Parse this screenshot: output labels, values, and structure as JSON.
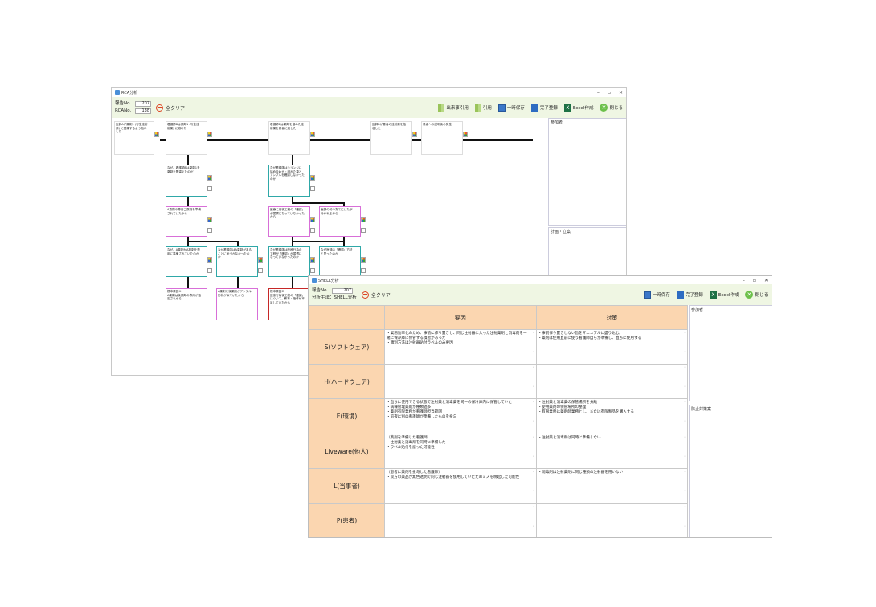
{
  "rca_window": {
    "title": "RCA分析",
    "report_no_label": "報告No.",
    "report_no": "207",
    "rca_no_label": "RCANo.",
    "rca_no": "138",
    "clear_label": "全クリア",
    "toolbar": {
      "source_event": "出来事引用",
      "cite": "引用",
      "temp_save": "一時保存",
      "complete": "完了登録",
      "excel": "Excel作成",
      "close": "閉じる"
    },
    "participants_label": "参加者",
    "plan_label": "計画・立案",
    "nodes": {
      "n1": "医師Aが薬剤1 (写生注射薬) に発薬するよう指示した",
      "n2": "看護師Bは薬剤1 (写生注射薬) に溶めた",
      "n3": "看護師Bは薬剤を溶めた注射薬を患者に渡した",
      "n4": "医師Bが患者の注射薬を指名した",
      "n5": "患者への説明後の発生",
      "t1": "なぜ、看護師Bは薬剤1を薬剤を間違えたのか？",
      "t2": "なぜ看護師はシリンジに詰め合わせ・誤れた薬とアンプルを確認しなかったのか",
      "p1": "A薬剤の専用ご薬剤を準備されていたから",
      "p2": "医療に用後工程の「確認」が習慣になっていなかったから",
      "p3": "医師の可の為てにいたが分かれるから",
      "t3": "なぜ、A薬剤がA薬剤を専用に準備されていたのか",
      "t4": "なぜ看護師はA薬剤があることに気づかなかったのか",
      "t5": "なぜ看護師は医療行為の工程が「確認」が習慣になっていなかったのか",
      "t6": "なぜ医師は「確認」方法と思ったのか",
      "r1": "根本原因①",
      "r1b": "A薬剤は後薬剤の専用が指定されから",
      "r2": "A薬剤と後薬剤がアンプル形状が似ていたから",
      "r3": "根本原因②",
      "r3b": "医療行為後工程の「確認」について、教育・指導が不足していたから"
    }
  },
  "shell_window": {
    "title": "SHELL分析",
    "report_no_label": "報告No.",
    "report_no": "207",
    "method_label": "分析手法：SHELL分析",
    "clear_label": "全クリア",
    "toolbar": {
      "temp_save": "一時保存",
      "complete": "完了登録",
      "excel": "Excel作成",
      "close": "閉じる"
    },
    "col_cause": "要因",
    "col_measure": "対策",
    "participants_label": "参加者",
    "prevention_label": "防止対策案",
    "rows": [
      {
        "label": "S(ソフトウェア)",
        "cause": "・業務効率化のため、事前に作り置きし、同じ注射器に入った注射薬剤と消毒剤を一緒に保冷庫に保管する慣習があった\n・識別方法は注射器貼付ラベルのみ要因",
        "measure": "・事前作り置きしない旨をマニュアルに盛り込む。\n・薬剤は使用直前に使う看護師自らが準備し、直ちに使用する"
      },
      {
        "label": "H(ハードウェア)",
        "cause": "",
        "measure": ""
      },
      {
        "label": "E(環境)",
        "cause": "・直ちに使用できる状態で注射薬と消毒薬を同一の保冷庫内に保管していた\n・病棟管理薬剤が種類過多\n・薬剤有限業務が看護師担当範囲\n・前夜に別の看護師が準備したものを投与",
        "measure": "・注射薬と消毒薬の保管場所を分離\n・使用薬剤の保管場所の整理\n・有限業務は薬剤師業務とし、または有限製品を購入する"
      },
      {
        "label": "Liveware(他人)",
        "cause": "（薬剤を準備した看護師）\n・注射薬と消毒剤を同時に準備した\n・ラベル貼付を誤った可能性",
        "measure": "・注射薬と消毒剤は同時に準備しない"
      },
      {
        "label": "L(当事者)",
        "cause": "（患者に薬剤を投与した看護師）\n・双方の薬品が無色透明で同じ注射器を使用していたためミスを晩起した可能性",
        "measure": "・消毒剤は注射薬剤に同じ種類の注射器を用いない"
      },
      {
        "label": "P(患者)",
        "cause": "",
        "measure": ""
      }
    ]
  }
}
